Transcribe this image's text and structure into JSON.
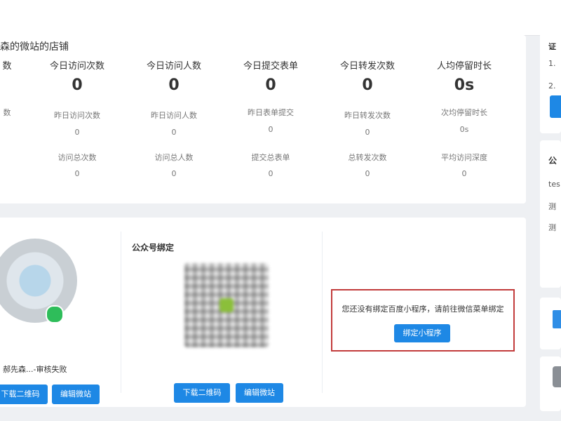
{
  "shop": {
    "title": "森的微站的店铺"
  },
  "stats": [
    {
      "label": "数",
      "value": "",
      "sub1_label": "数",
      "sub1_value": "",
      "sub2_label": "",
      "sub2_value": ""
    },
    {
      "label": "今日访问次数",
      "value": "0",
      "sub1_label": "昨日访问次数",
      "sub1_value": "0",
      "sub2_label": "访问总次数",
      "sub2_value": "0"
    },
    {
      "label": "今日访问人数",
      "value": "0",
      "sub1_label": "昨日访问人数",
      "sub1_value": "0",
      "sub2_label": "访问总人数",
      "sub2_value": "0"
    },
    {
      "label": "今日提交表单",
      "value": "0",
      "sub1_label": "昨日表单提交",
      "sub1_value": "0",
      "sub2_label": "提交总表单",
      "sub2_value": "0"
    },
    {
      "label": "今日转发次数",
      "value": "0",
      "sub1_label": "昨日转发次数",
      "sub1_value": "0",
      "sub2_label": "总转发次数",
      "sub2_value": "0"
    },
    {
      "label": "人均停留时长",
      "value": "0s",
      "sub1_label": "次均停留时长",
      "sub1_value": "0s",
      "sub2_label": "平均访问深度",
      "sub2_value": "0"
    }
  ],
  "bindings": {
    "left": {
      "caption": "郝先森...-审核失败",
      "download_label": "下载二维码",
      "edit_label": "编辑微站"
    },
    "official": {
      "title": "公众号绑定",
      "download_label": "下载二维码",
      "edit_label": "编辑微站"
    },
    "baidu": {
      "message": "您还没有绑定百度小程序，请前往微信菜单绑定",
      "bind_label": "绑定小程序"
    }
  },
  "side": {
    "card1": {
      "title": "证",
      "item1": "1.",
      "item2": "2."
    },
    "card2": {
      "title": "公",
      "line1": "tes",
      "line2": "测",
      "line3": "测"
    }
  },
  "colors": {
    "primary": "#1e88e5",
    "highlight_border": "#c23b3b",
    "success": "#2ebd5a"
  }
}
